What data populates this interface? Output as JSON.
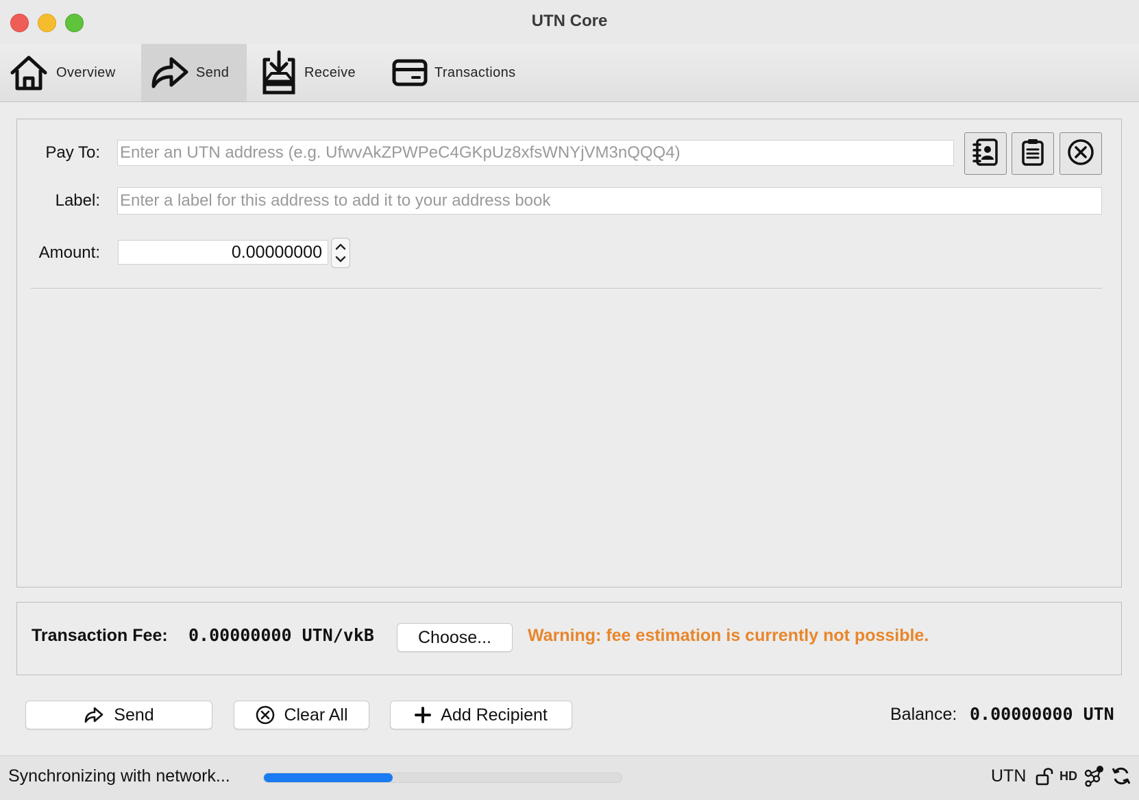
{
  "window": {
    "title": "UTN Core"
  },
  "toolbar": {
    "tabs": [
      {
        "label": "Overview",
        "icon": "home-icon",
        "active": false
      },
      {
        "label": "Send",
        "icon": "send-arrow-icon",
        "active": true
      },
      {
        "label": "Receive",
        "icon": "receive-tray-icon",
        "active": false
      },
      {
        "label": "Transactions",
        "icon": "card-icon",
        "active": false
      }
    ]
  },
  "recipient": {
    "pay_to_label": "Pay To:",
    "pay_to_placeholder": "Enter an UTN address (e.g. UfwvAkZPWPeC4GKpUz8xfsWNYjVM3nQQQ4)",
    "pay_to_value": "",
    "label_label": "Label:",
    "label_placeholder": "Enter a label for this address to add it to your address book",
    "label_value": "",
    "amount_label": "Amount:",
    "amount_value": "0.00000000",
    "buttons": [
      "address-book-icon",
      "paste-icon",
      "clear-circle-x-icon"
    ]
  },
  "fee": {
    "label": "Transaction Fee:",
    "value": "0.00000000 UTN/vkB",
    "choose_label": "Choose...",
    "warning": "Warning: fee estimation is currently not possible.",
    "warning_color": "#e8862b"
  },
  "actions": {
    "send_label": "Send",
    "clear_label": "Clear All",
    "add_label": "Add Recipient"
  },
  "balance": {
    "label": "Balance:",
    "value": "0.00000000 UTN"
  },
  "status": {
    "sync_text": "Synchronizing with network...",
    "sync_progress": 0.36,
    "progress_color": "#1a7bf2",
    "unit": "UTN",
    "icons": [
      "lock-open-icon",
      "hd-icon",
      "network-icon",
      "sync-icon"
    ],
    "hd_text": "HD"
  }
}
